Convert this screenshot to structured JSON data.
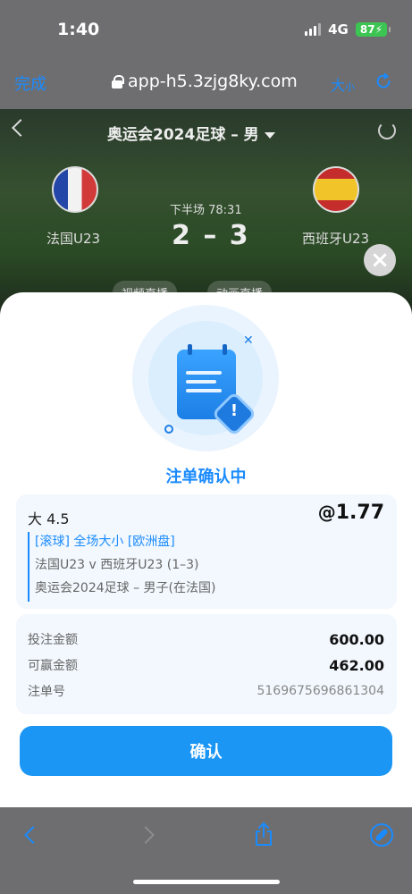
{
  "status": {
    "time": "1:40",
    "network": "4G",
    "battery": "87"
  },
  "browser": {
    "done_label": "完成",
    "url": "app-h5.3zjg8ky.com",
    "text_size_big": "大",
    "text_size_small": "小"
  },
  "match": {
    "league": "奥运会2024足球 – 男",
    "home_team": "法国U23",
    "away_team": "西班牙U23",
    "period": "下半场 78:31",
    "score": "2 – 3",
    "video_btn": "视频直播",
    "anim_btn": "动画直播"
  },
  "sheet": {
    "title": "注单确认中",
    "selection": "大 4.5",
    "odds_at": "@",
    "odds": "1.77",
    "market": "[滚球] 全场大小 [欧洲盘]",
    "fixture": "法国U23 v 西班牙U23 (1–3)",
    "competition": "奥运会2024足球 – 男子(在法国)",
    "stake_label": "投注金额",
    "stake_value": "600.00",
    "win_label": "可赢金额",
    "win_value": "462.00",
    "ticket_label": "注单号",
    "ticket_value": "5169675696861304",
    "confirm_label": "确认",
    "close_label": "×"
  },
  "icons": [
    "lock-icon",
    "refresh-icon",
    "back-icon",
    "forward-icon",
    "share-icon",
    "compass-icon",
    "close-icon"
  ]
}
